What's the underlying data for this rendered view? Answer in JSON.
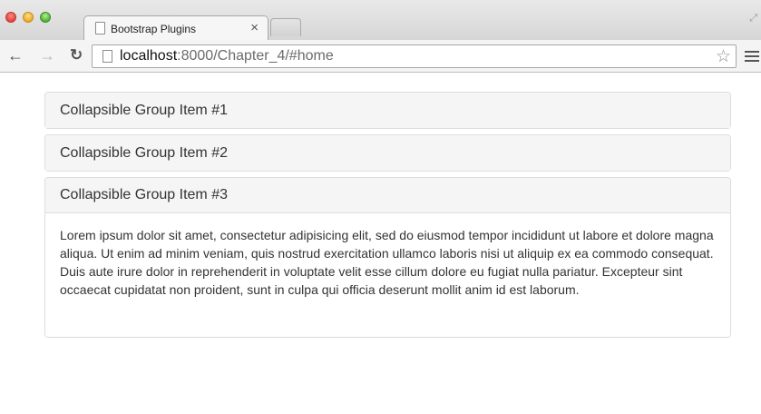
{
  "browser": {
    "tab_title": "Bootstrap Plugins",
    "tab_close": "×",
    "url_host": "localhost",
    "url_rest": ":8000/Chapter_4/#home",
    "icons": [
      "close-window-icon",
      "minimize-icon",
      "zoom-icon",
      "back-arrow-icon",
      "forward-arrow-icon",
      "reload-icon",
      "page-icon",
      "star-icon",
      "menu-icon",
      "fullscreen-icon"
    ]
  },
  "accordion": {
    "items": [
      {
        "title": "Collapsible Group Item #1"
      },
      {
        "title": "Collapsible Group Item #2"
      },
      {
        "title": "Collapsible Group Item #3",
        "body": "Lorem ipsum dolor sit amet, consectetur adipisicing elit, sed do eiusmod tempor incididunt ut labore et dolore magna aliqua. Ut enim ad minim veniam, quis nostrud exercitation ullamco laboris nisi ut aliquip ex ea commodo consequat. Duis aute irure dolor in reprehenderit in voluptate velit esse cillum dolore eu fugiat nulla pariatur. Excepteur sint occaecat cupidatat non proident, sunt in culpa qui officia deserunt mollit anim id est laborum."
      }
    ]
  }
}
